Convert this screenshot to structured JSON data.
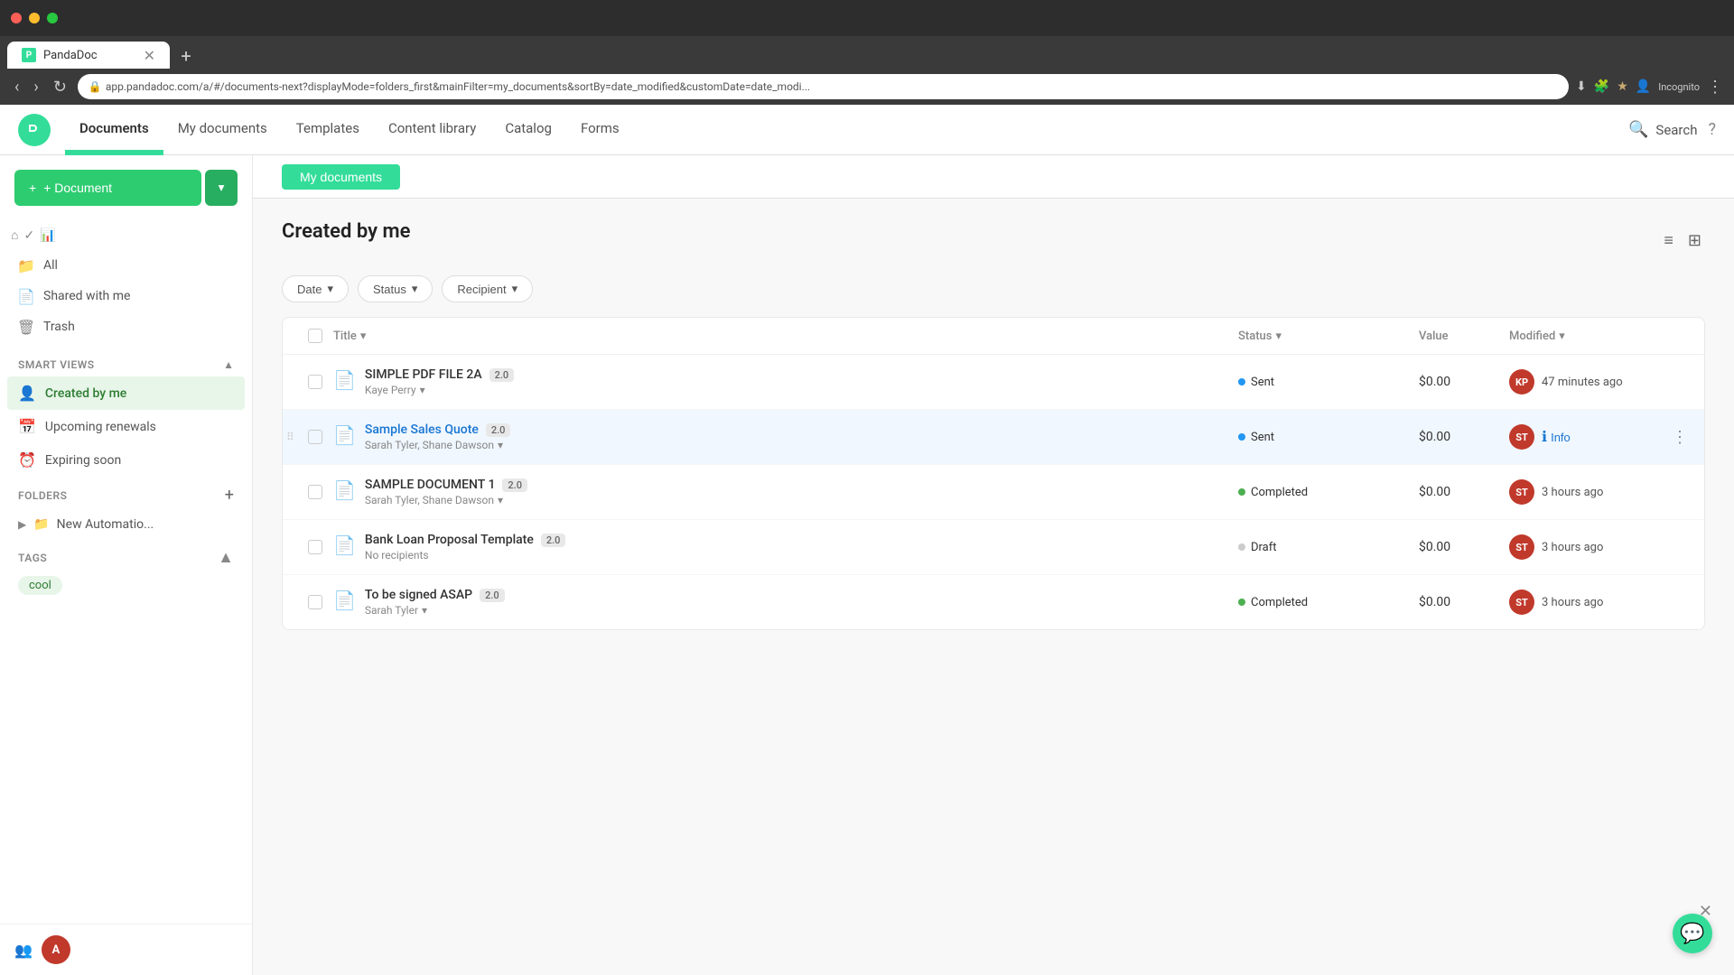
{
  "browser": {
    "tab_title": "PandaDoc",
    "url": "app.pandadoc.com/a/#/documents-next?displayMode=folders_first&mainFilter=my_documents&sortBy=date_modified&customDate=date_modi..."
  },
  "nav": {
    "logo_text": "P",
    "items": [
      {
        "id": "documents",
        "label": "Documents",
        "active": true
      },
      {
        "id": "my_documents",
        "label": "My documents",
        "active": false
      },
      {
        "id": "templates",
        "label": "Templates",
        "active": false
      },
      {
        "id": "content_library",
        "label": "Content library",
        "active": false
      },
      {
        "id": "catalog",
        "label": "Catalog",
        "active": false
      },
      {
        "id": "forms",
        "label": "Forms",
        "active": false
      }
    ],
    "search_label": "Search",
    "help_icon": "?"
  },
  "sidebar": {
    "add_document_label": "+ Document",
    "nav_items": [
      {
        "id": "all",
        "label": "All",
        "icon": "📁"
      },
      {
        "id": "shared",
        "label": "Shared with me",
        "icon": "📄"
      },
      {
        "id": "trash",
        "label": "Trash",
        "icon": "🗑"
      }
    ],
    "smart_views": {
      "title": "SMART VIEWS",
      "items": [
        {
          "id": "created_by_me",
          "label": "Created by me",
          "icon": "👤",
          "active": true
        },
        {
          "id": "upcoming_renewals",
          "label": "Upcoming renewals",
          "icon": "📅",
          "active": false
        },
        {
          "id": "expiring_soon",
          "label": "Expiring soon",
          "icon": "⏰",
          "active": false
        }
      ]
    },
    "folders": {
      "title": "FOLDERS",
      "add_icon": "+",
      "items": [
        {
          "id": "new_automation",
          "label": "New Automatio...",
          "icon": "📁"
        }
      ]
    },
    "tags": {
      "title": "TAGS",
      "items": [
        "cool"
      ]
    }
  },
  "content": {
    "section_title": "Created by me",
    "filters": [
      {
        "id": "date",
        "label": "Date"
      },
      {
        "id": "status",
        "label": "Status"
      },
      {
        "id": "recipient",
        "label": "Recipient"
      }
    ],
    "table": {
      "headers": {
        "title": "Title",
        "status": "Status",
        "value": "Value",
        "modified": "Modified"
      },
      "rows": [
        {
          "id": "row1",
          "title": "SIMPLE PDF FILE 2A",
          "version": "2.0",
          "recipients": "Kaye Perry",
          "recipients_has_dropdown": true,
          "status": "Sent",
          "status_type": "sent",
          "value": "$0.00",
          "modified": "47 minutes ago",
          "is_link": false,
          "highlighted": false
        },
        {
          "id": "row2",
          "title": "Sample Sales Quote",
          "version": "2.0",
          "recipients": "Sarah Tyler, Shane Dawson",
          "recipients_has_dropdown": true,
          "status": "Sent",
          "status_type": "sent",
          "value": "$0.00",
          "modified": "",
          "info_btn": "Info",
          "is_link": true,
          "highlighted": true
        },
        {
          "id": "row3",
          "title": "SAMPLE DOCUMENT 1",
          "version": "2.0",
          "recipients": "Sarah Tyler, Shane Dawson",
          "recipients_has_dropdown": true,
          "status": "Completed",
          "status_type": "completed",
          "value": "$0.00",
          "modified": "3 hours ago",
          "is_link": false,
          "highlighted": false
        },
        {
          "id": "row4",
          "title": "Bank Loan Proposal Template",
          "version": "2.0",
          "recipients": "No recipients",
          "recipients_has_dropdown": false,
          "status": "Draft",
          "status_type": "draft",
          "value": "$0.00",
          "modified": "3 hours ago",
          "is_link": false,
          "highlighted": false
        },
        {
          "id": "row5",
          "title": "To be signed ASAP",
          "version": "2.0",
          "recipients": "Sarah Tyler",
          "recipients_has_dropdown": true,
          "status": "Completed",
          "status_type": "completed",
          "value": "$0.00",
          "modified": "3 hours ago",
          "is_link": false,
          "highlighted": false
        }
      ]
    }
  },
  "icons": {
    "add": "+",
    "dropdown_arrow": "▾",
    "filter_icon": "⚙",
    "sort_icon": "☰",
    "drag_dots": "⋮⋮",
    "info_circle": "ℹ",
    "more_menu": "⋮",
    "close": "✕",
    "chat": "💬",
    "chevron_right": "▶",
    "chevron_down": "▾",
    "folder": "📁"
  }
}
